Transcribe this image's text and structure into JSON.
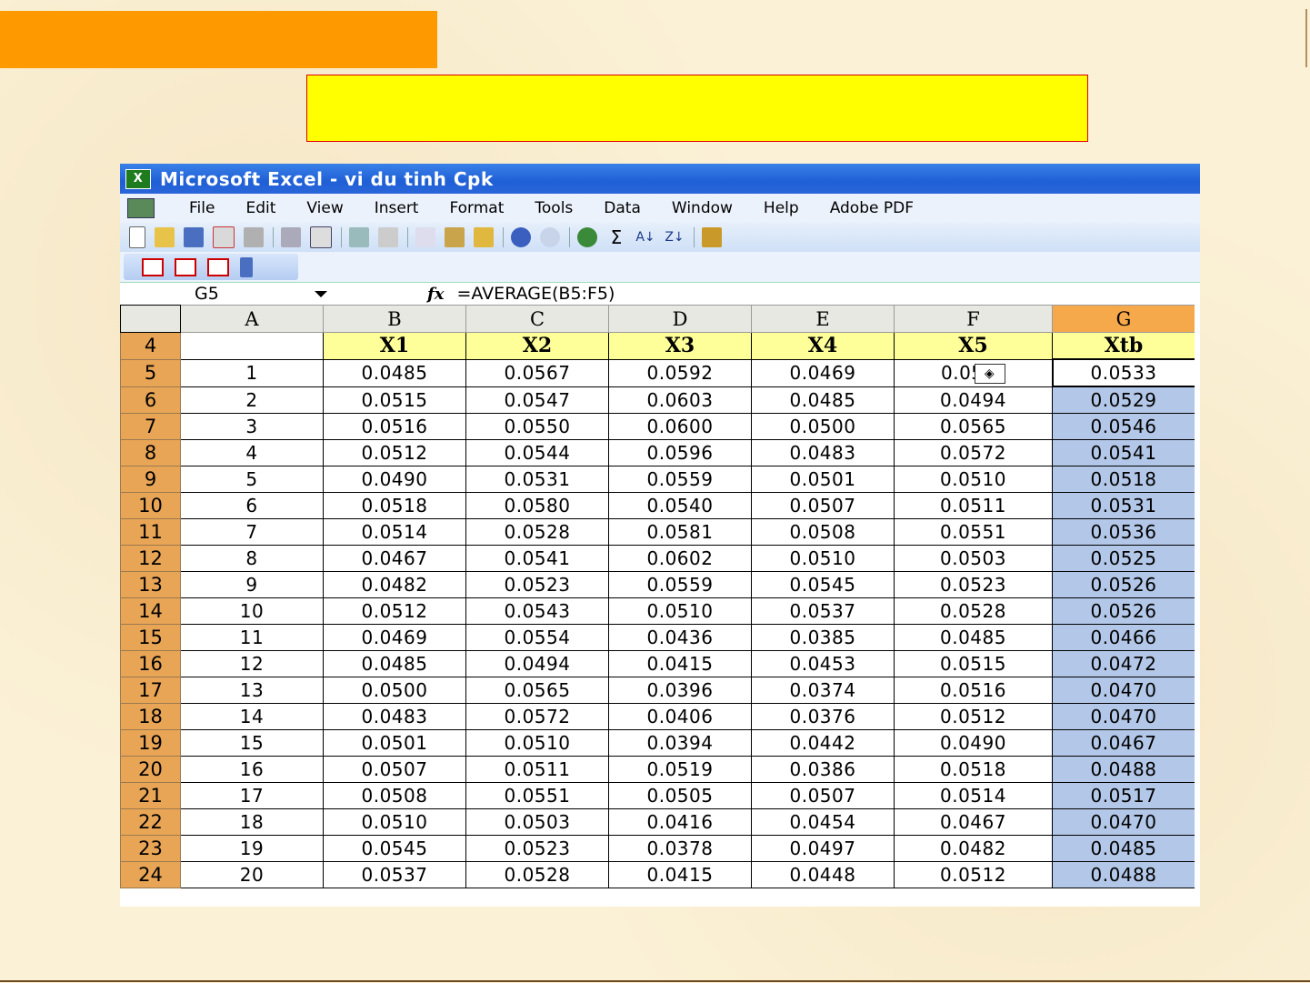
{
  "window": {
    "title": "Microsoft Excel - vi du tinh Cpk"
  },
  "menu": [
    "File",
    "Edit",
    "View",
    "Insert",
    "Format",
    "Tools",
    "Data",
    "Window",
    "Help",
    "Adobe PDF"
  ],
  "formula_bar": {
    "name_box": "G5",
    "fx": "fx",
    "formula": "=AVERAGE(B5:F5)"
  },
  "columns": [
    "A",
    "B",
    "C",
    "D",
    "E",
    "F",
    "G"
  ],
  "header_row": {
    "row": "4",
    "cells": [
      "",
      "X1",
      "X2",
      "X3",
      "X4",
      "X5",
      "Xtb"
    ]
  },
  "rows": [
    {
      "row": "5",
      "cells": [
        "1",
        "0.0485",
        "0.0567",
        "0.0592",
        "0.0469",
        "0.05",
        "0.0533"
      ]
    },
    {
      "row": "6",
      "cells": [
        "2",
        "0.0515",
        "0.0547",
        "0.0603",
        "0.0485",
        "0.0494",
        "0.0529"
      ]
    },
    {
      "row": "7",
      "cells": [
        "3",
        "0.0516",
        "0.0550",
        "0.0600",
        "0.0500",
        "0.0565",
        "0.0546"
      ]
    },
    {
      "row": "8",
      "cells": [
        "4",
        "0.0512",
        "0.0544",
        "0.0596",
        "0.0483",
        "0.0572",
        "0.0541"
      ]
    },
    {
      "row": "9",
      "cells": [
        "5",
        "0.0490",
        "0.0531",
        "0.0559",
        "0.0501",
        "0.0510",
        "0.0518"
      ]
    },
    {
      "row": "10",
      "cells": [
        "6",
        "0.0518",
        "0.0580",
        "0.0540",
        "0.0507",
        "0.0511",
        "0.0531"
      ]
    },
    {
      "row": "11",
      "cells": [
        "7",
        "0.0514",
        "0.0528",
        "0.0581",
        "0.0508",
        "0.0551",
        "0.0536"
      ]
    },
    {
      "row": "12",
      "cells": [
        "8",
        "0.0467",
        "0.0541",
        "0.0602",
        "0.0510",
        "0.0503",
        "0.0525"
      ]
    },
    {
      "row": "13",
      "cells": [
        "9",
        "0.0482",
        "0.0523",
        "0.0559",
        "0.0545",
        "0.0523",
        "0.0526"
      ]
    },
    {
      "row": "14",
      "cells": [
        "10",
        "0.0512",
        "0.0543",
        "0.0510",
        "0.0537",
        "0.0528",
        "0.0526"
      ]
    },
    {
      "row": "15",
      "cells": [
        "11",
        "0.0469",
        "0.0554",
        "0.0436",
        "0.0385",
        "0.0485",
        "0.0466"
      ]
    },
    {
      "row": "16",
      "cells": [
        "12",
        "0.0485",
        "0.0494",
        "0.0415",
        "0.0453",
        "0.0515",
        "0.0472"
      ]
    },
    {
      "row": "17",
      "cells": [
        "13",
        "0.0500",
        "0.0565",
        "0.0396",
        "0.0374",
        "0.0516",
        "0.0470"
      ]
    },
    {
      "row": "18",
      "cells": [
        "14",
        "0.0483",
        "0.0572",
        "0.0406",
        "0.0376",
        "0.0512",
        "0.0470"
      ]
    },
    {
      "row": "19",
      "cells": [
        "15",
        "0.0501",
        "0.0510",
        "0.0394",
        "0.0442",
        "0.0490",
        "0.0467"
      ]
    },
    {
      "row": "20",
      "cells": [
        "16",
        "0.0507",
        "0.0511",
        "0.0519",
        "0.0386",
        "0.0518",
        "0.0488"
      ]
    },
    {
      "row": "21",
      "cells": [
        "17",
        "0.0508",
        "0.0551",
        "0.0505",
        "0.0507",
        "0.0514",
        "0.0517"
      ]
    },
    {
      "row": "22",
      "cells": [
        "18",
        "0.0510",
        "0.0503",
        "0.0416",
        "0.0454",
        "0.0467",
        "0.0470"
      ]
    },
    {
      "row": "23",
      "cells": [
        "19",
        "0.0545",
        "0.0523",
        "0.0378",
        "0.0497",
        "0.0482",
        "0.0485"
      ]
    },
    {
      "row": "24",
      "cells": [
        "20",
        "0.0537",
        "0.0528",
        "0.0415",
        "0.0448",
        "0.0512",
        "0.0488"
      ]
    }
  ],
  "colors": {
    "orange_bar": "#ff9900",
    "yellow_box": "#ffff00",
    "row_header": "#e9a556",
    "selection": "#b3c7e8"
  },
  "icons": [
    "excel-logo-icon",
    "new-icon",
    "open-icon",
    "save-icon",
    "permission-icon",
    "print-icon",
    "print-preview-icon",
    "spelling-icon",
    "research-icon",
    "cut-icon",
    "copy-icon",
    "paste-icon",
    "format-painter-icon",
    "undo-icon",
    "redo-icon",
    "hyperlink-icon",
    "autosum-icon",
    "sort-ascending-icon",
    "sort-descending-icon",
    "chart-wizard-icon",
    "convert-to-pdf-icon",
    "error-check-icon"
  ]
}
